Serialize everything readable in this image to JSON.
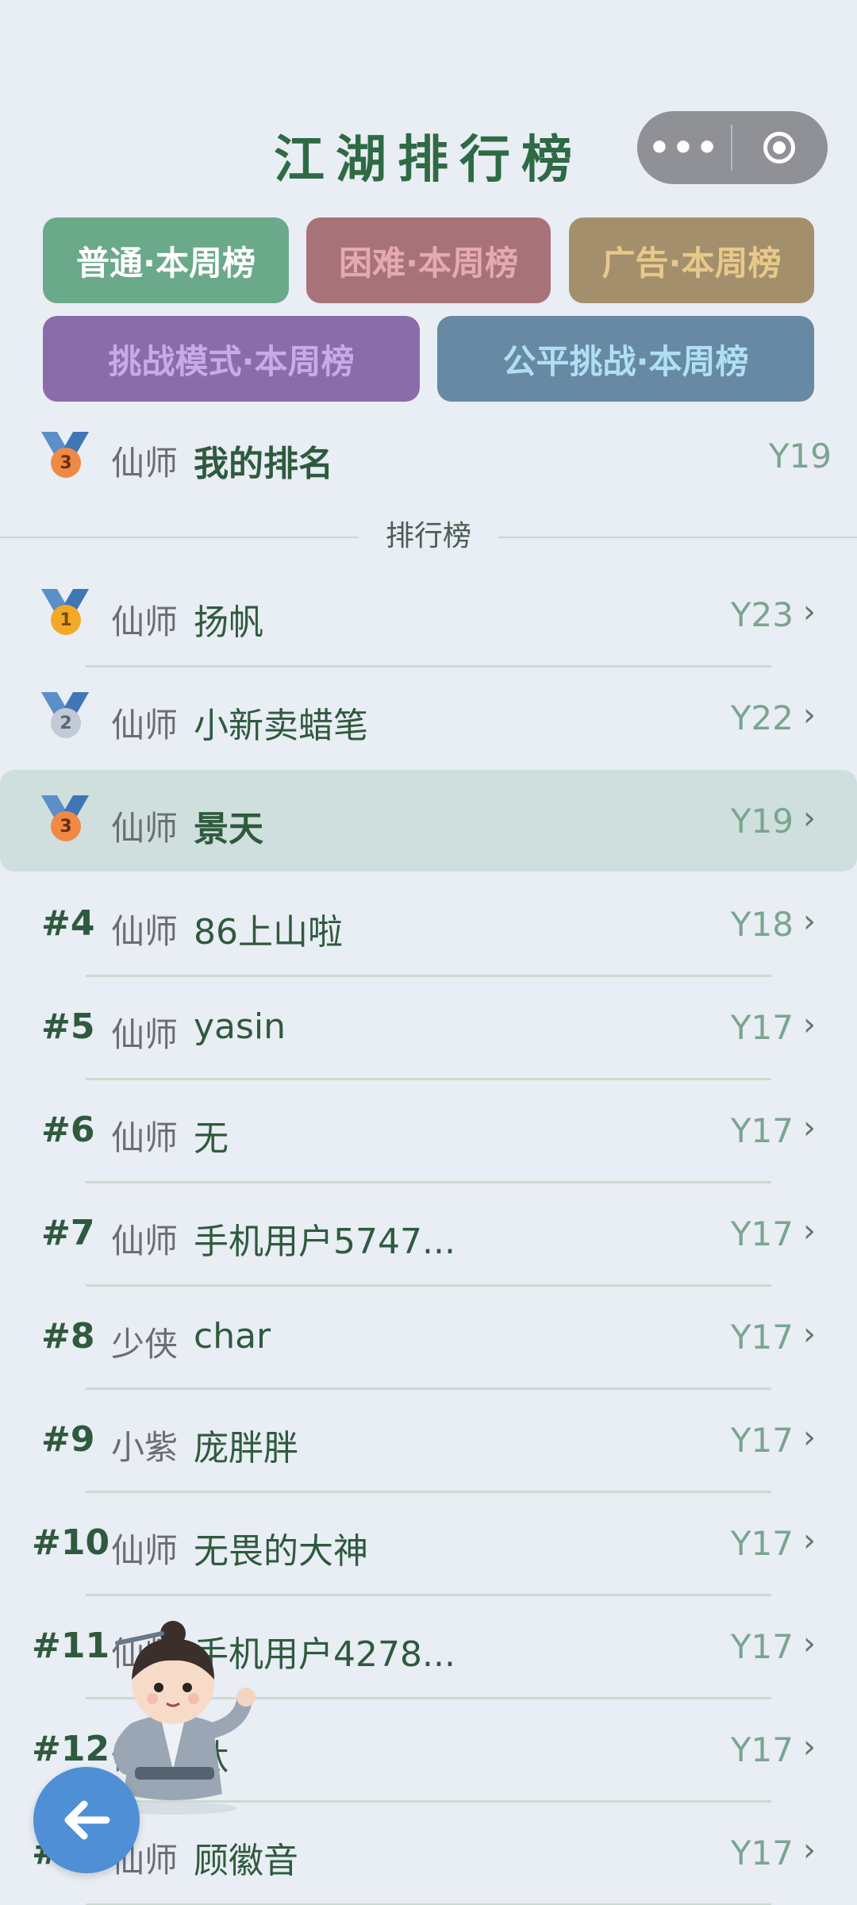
{
  "title": "江湖排行榜",
  "capsule": {
    "more_label": "•••"
  },
  "modes": [
    {
      "label": "普通·本周榜"
    },
    {
      "label": "困难·本周榜"
    },
    {
      "label": "广告·本周榜"
    },
    {
      "label": "挑战模式·本周榜"
    },
    {
      "label": "公平挑战·本周榜"
    }
  ],
  "my_rank": {
    "medal": "3",
    "role": "仙师",
    "name": "我的排名",
    "score": "Y19"
  },
  "divider_label": "排行榜",
  "rows": [
    {
      "rank": "1",
      "medal": "gold",
      "role": "仙师",
      "name": "扬帆",
      "score": "Y23",
      "chevron": "›"
    },
    {
      "rank": "2",
      "medal": "silver",
      "role": "仙师",
      "name": "小新卖蜡笔",
      "score": "Y22",
      "chevron": "›"
    },
    {
      "rank": "3",
      "medal": "bronze",
      "role": "仙师",
      "name": "景天",
      "score": "Y19",
      "chevron": "›"
    },
    {
      "rank": "#4",
      "role": "仙师",
      "name": "86上山啦",
      "score": "Y18",
      "chevron": "›"
    },
    {
      "rank": "#5",
      "role": "仙师",
      "name": "yasin",
      "score": "Y17",
      "chevron": "›"
    },
    {
      "rank": "#6",
      "role": "仙师",
      "name": "无",
      "score": "Y17",
      "chevron": "›"
    },
    {
      "rank": "#7",
      "role": "仙师",
      "name": "手机用户5747...",
      "score": "Y17",
      "chevron": "›"
    },
    {
      "rank": "#8",
      "role": "少侠",
      "name": "char",
      "score": "Y17",
      "chevron": "›"
    },
    {
      "rank": "#9",
      "role": "小紫",
      "name": "庞胖胖",
      "score": "Y17",
      "chevron": "›"
    },
    {
      "rank": "#10",
      "role": "仙师",
      "name": "无畏的大神",
      "score": "Y17",
      "chevron": "›"
    },
    {
      "rank": "#11",
      "role": "仙师",
      "name": "手机用户4278...",
      "score": "Y17",
      "chevron": "›"
    },
    {
      "rank": "#12",
      "role": "仙师",
      "name": "钛",
      "score": "Y17",
      "chevron": "›"
    },
    {
      "rank": "#13",
      "role": "仙师",
      "name": "顾徽音",
      "score": "Y17",
      "chevron": "›"
    }
  ],
  "colors": {
    "background": "#e9edf4",
    "accent_green": "#2e6a43",
    "highlight_row": "#cfdfdd",
    "back_button": "#4f8fd6"
  },
  "icons": {
    "capsule_more": "more-dots-icon",
    "capsule_close": "target-circle-icon",
    "back": "arrow-left-icon",
    "chevron": "chevron-right-icon"
  }
}
